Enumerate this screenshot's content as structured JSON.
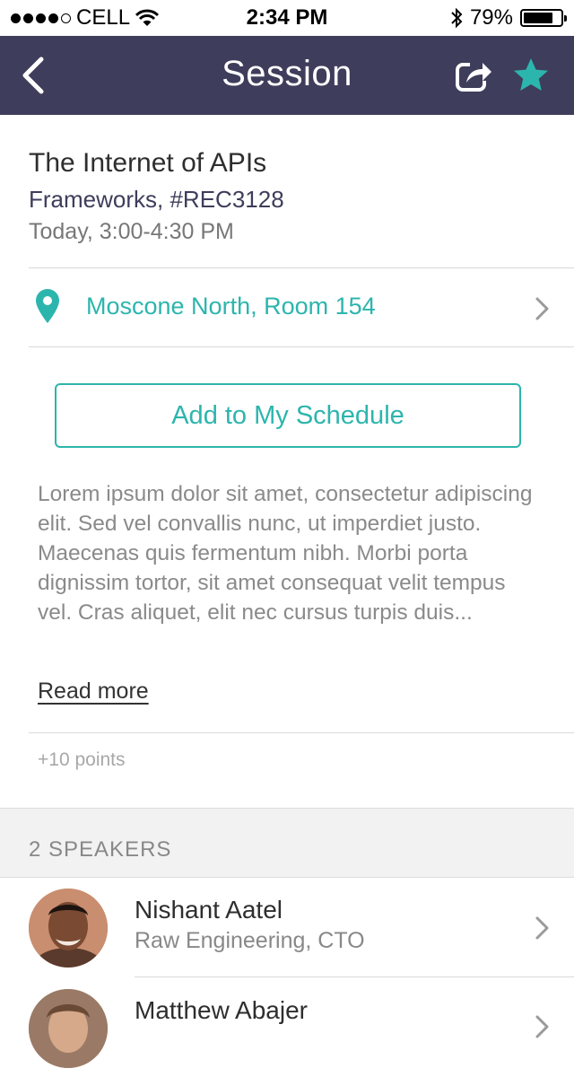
{
  "status_bar": {
    "carrier": "CELL",
    "time": "2:34 PM",
    "battery_percent": "79%",
    "battery_level": 0.79,
    "signal_bars_filled": 4,
    "signal_bars_total": 5
  },
  "nav": {
    "title": "Session",
    "back_icon": "chevron-left-icon",
    "share_icon": "share-icon",
    "favorite_icon": "star-icon"
  },
  "session": {
    "title": "The Internet of APIs",
    "track": "Frameworks, #REC3128",
    "time": "Today, 3:00-4:30 PM",
    "location": "Moscone North, Room 154",
    "add_button_label": "Add to My Schedule",
    "description": "Lorem ipsum dolor sit amet, consectetur adipiscing elit. Sed vel convallis nunc, ut imperdiet justo. Maecenas quis fermentum nibh. Morbi porta dignissim tortor, sit amet consequat velit tempus vel. Cras aliquet, elit nec cursus turpis duis...",
    "read_more_label": "Read more",
    "points": "+10 points"
  },
  "speakers": {
    "header": "2 SPEAKERS",
    "items": [
      {
        "name": "Nishant Aatel",
        "role": "Raw Engineering, CTO"
      },
      {
        "name": "Matthew Abajer",
        "role": ""
      }
    ]
  },
  "colors": {
    "nav_background": "#3e3d5b",
    "accent": "#2cb5ad"
  }
}
